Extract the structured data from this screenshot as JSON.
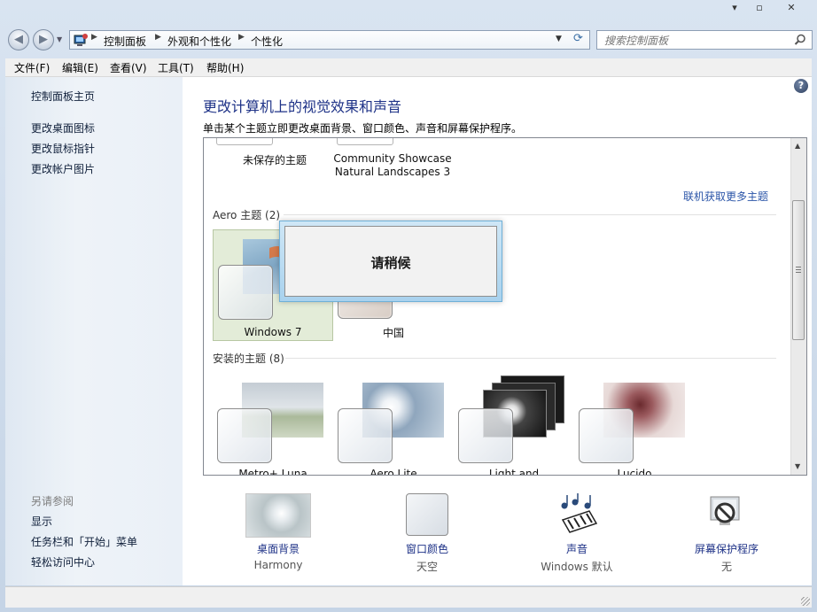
{
  "window": {
    "controls": {
      "minimize": "▾",
      "maximize": "▫",
      "close": "✕"
    }
  },
  "address": {
    "crumbs": [
      "控制面板",
      "外观和个性化",
      "个性化"
    ],
    "search_placeholder": "搜索控制面板"
  },
  "menu": [
    "文件(F)",
    "编辑(E)",
    "查看(V)",
    "工具(T)",
    "帮助(H)"
  ],
  "sidebar": {
    "home": "控制面板主页",
    "links": [
      "更改桌面图标",
      "更改鼠标指针",
      "更改帐户图片"
    ],
    "see_also_heading": "另请参阅",
    "see_also": [
      "显示",
      "任务栏和「开始」菜单",
      "轻松访问中心"
    ]
  },
  "main": {
    "title": "更改计算机上的视觉效果和声音",
    "description": "单击某个主题立即更改桌面背景、窗口颜色、声音和屏幕保护程序。",
    "my_themes": [
      {
        "name": "未保存的主题"
      },
      {
        "name": "Community Showcase\nNatural Landscapes 3"
      }
    ],
    "more_themes_link": "联机获取更多主题",
    "aero_group": "Aero 主题 (2)",
    "aero_themes": [
      {
        "name": "Windows 7",
        "selected": true
      },
      {
        "name": "中国",
        "selected": false
      }
    ],
    "installed_group": "安装的主题 (8)",
    "installed_themes": [
      {
        "name": "Metro+ Luna"
      },
      {
        "name": "Aero Lite"
      },
      {
        "name": "Light and"
      },
      {
        "name": "Lucido"
      }
    ]
  },
  "dialog": {
    "text": "请稍候"
  },
  "bottom": [
    {
      "label": "桌面背景",
      "value": "Harmony",
      "icon": "desktop-background-icon"
    },
    {
      "label": "窗口颜色",
      "value": "天空",
      "icon": "window-color-icon"
    },
    {
      "label": "声音",
      "value": "Windows 默认",
      "icon": "sound-icon"
    },
    {
      "label": "屏幕保护程序",
      "value": "无",
      "icon": "screensaver-icon"
    }
  ],
  "colors": {
    "accent": "#1e3287",
    "link": "#2b55a8",
    "selected_tile": "#e3ecd8"
  }
}
